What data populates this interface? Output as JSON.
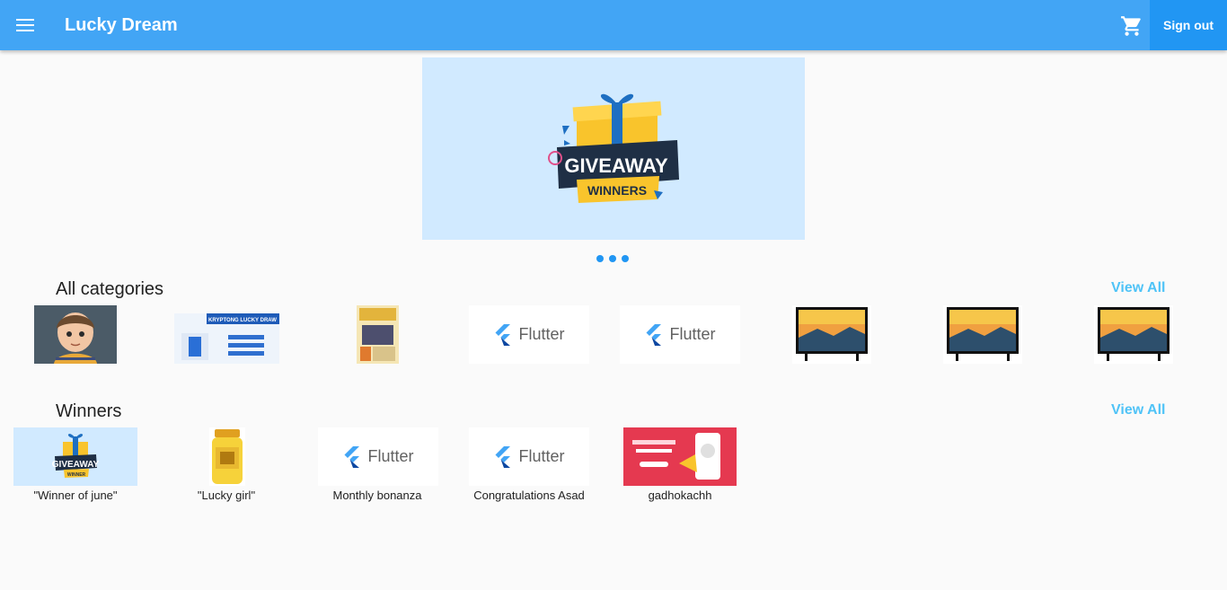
{
  "app": {
    "title": "Lucky Dream"
  },
  "header": {
    "sign_out_label": "Sign out",
    "menu_icon": "menu-icon",
    "cart_icon": "shopping-cart-icon"
  },
  "banner": {
    "headline": "GIVEAWAY",
    "subline": "WINNERS",
    "active_slide": 1,
    "slide_count": 3
  },
  "categories": {
    "title": "All categories",
    "view_all_label": "View All",
    "items": [
      {
        "kind": "cartoon-boy-image"
      },
      {
        "kind": "lucky-draw-banner-image",
        "text": "KRYPTONG LUCKY DRAW"
      },
      {
        "kind": "poster-image"
      },
      {
        "kind": "flutter-placeholder",
        "text": "Flutter"
      },
      {
        "kind": "flutter-placeholder",
        "text": "Flutter"
      },
      {
        "kind": "tv-image"
      },
      {
        "kind": "tv-image"
      },
      {
        "kind": "tv-image"
      }
    ]
  },
  "winners": {
    "title": "Winners",
    "view_all_label": "View All",
    "items": [
      {
        "caption": "\"Winner of june\"",
        "kind": "giveaway-image",
        "image_text": "GIVEAWAY",
        "image_subtext": "WINNER"
      },
      {
        "caption": "\"Lucky girl\"",
        "kind": "jar-image"
      },
      {
        "caption": "Monthly bonanza",
        "kind": "flutter-placeholder",
        "image_text": "Flutter"
      },
      {
        "caption": "Congratulations Asad",
        "kind": "flutter-placeholder",
        "image_text": "Flutter"
      },
      {
        "caption": "gadhokachh",
        "kind": "promo-image"
      }
    ]
  },
  "colors": {
    "appbar": "#42a5f5",
    "sign_out": "#2196f3",
    "view_all": "#4fc3f7",
    "banner_bg": "#d1eaff"
  }
}
